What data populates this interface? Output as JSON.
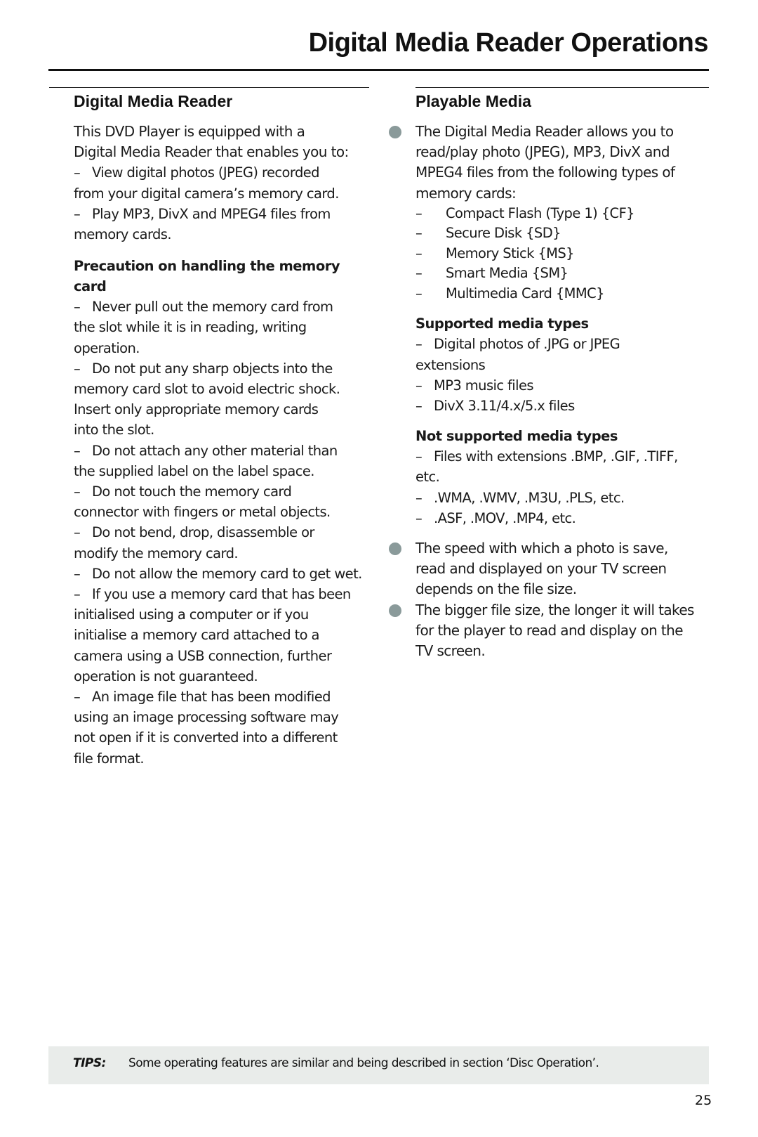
{
  "page": {
    "title": "Digital Media Reader Operations",
    "page_number": "25"
  },
  "left_column": {
    "heading": "Digital Media Reader",
    "intro_lines": [
      "This DVD Player is equipped with a",
      "Digital Media Reader that enables you to:"
    ],
    "features": [
      {
        "dash": "–",
        "text": "View digital photos (JPEG) recorded",
        "cont": "from your digital camera’s memory card."
      },
      {
        "dash": "–",
        "text": "Play MP3, DivX and MPEG4 files from",
        "cont": "memory cards."
      }
    ],
    "precaution_heading_line1": "Precaution on handling the memory",
    "precaution_heading_line2": "card",
    "precautions": [
      {
        "dash": "–",
        "lines": [
          "Never pull out the memory card from",
          "the slot while it is in reading, writing",
          "operation."
        ]
      },
      {
        "dash": "–",
        "lines": [
          "Do not put any sharp objects into the",
          "memory card slot to avoid electric shock.",
          "Insert only appropriate memory cards",
          "into the slot."
        ]
      },
      {
        "dash": "–",
        "lines": [
          "Do not attach any other material than",
          "the supplied label on the label space."
        ]
      },
      {
        "dash": "–",
        "lines": [
          "Do not touch the memory card",
          "connector with fingers or metal objects."
        ]
      },
      {
        "dash": "–",
        "lines": [
          "Do not bend, drop, disassemble or",
          "modify the memory card."
        ]
      },
      {
        "dash": "–",
        "lines": [
          "Do not allow the memory card to get wet."
        ]
      },
      {
        "dash": "–",
        "lines": [
          "If you use a memory card that has been",
          "initialised using a computer or if you",
          "initialise a memory card attached to a",
          "camera using a USB connection, further",
          "operation is not guaranteed."
        ]
      },
      {
        "dash": "–",
        "lines": [
          "An image file that has been modified",
          "using an image processing software may",
          "not open if it is converted into a different",
          "file format."
        ]
      }
    ]
  },
  "right_column": {
    "heading": "Playable Media",
    "bullet1_lines": [
      "The Digital Media Reader allows you to",
      "read/play photo (JPEG), MP3, DivX and",
      "MPEG4 files from the following types of",
      "memory cards:"
    ],
    "memory_cards": [
      "Compact Flash (Type 1) {CF}",
      "Secure Disk {SD}",
      "Memory Stick {MS}",
      "Smart Media {SM}",
      "Multimedia Card {MMC}"
    ],
    "supported_heading": "Supported media types",
    "supported": [
      {
        "dash": "–",
        "text": "Digital photos of .JPG or JPEG",
        "cont": "extensions"
      },
      {
        "dash": "–",
        "text": "MP3 music files",
        "cont": null
      },
      {
        "dash": "–",
        "text": "DivX 3.11/4.x/5.x files",
        "cont": null
      }
    ],
    "not_supported_heading": "Not supported media types",
    "not_supported": [
      {
        "dash": "–",
        "text": "Files with extensions .BMP, .GIF, .TIFF,",
        "cont": "etc."
      },
      {
        "dash": "–",
        "text": ".WMA, .WMV, .M3U, .PLS, etc.",
        "cont": null
      },
      {
        "dash": "–",
        "text": ".ASF, .MOV, .MP4, etc.",
        "cont": null
      }
    ],
    "bullet2_lines": [
      "The speed with which a photo is save,",
      "read and displayed on your TV screen",
      "depends on the file size."
    ],
    "bullet3_lines": [
      "The bigger file size, the longer it will takes",
      "for the player to read and display on the",
      "TV screen."
    ],
    "bullet_color": "#8a9a9a"
  },
  "tips": {
    "label": "TIPS:",
    "text": "Some operating features are similar and being described in section ‘Disc Operation’."
  }
}
